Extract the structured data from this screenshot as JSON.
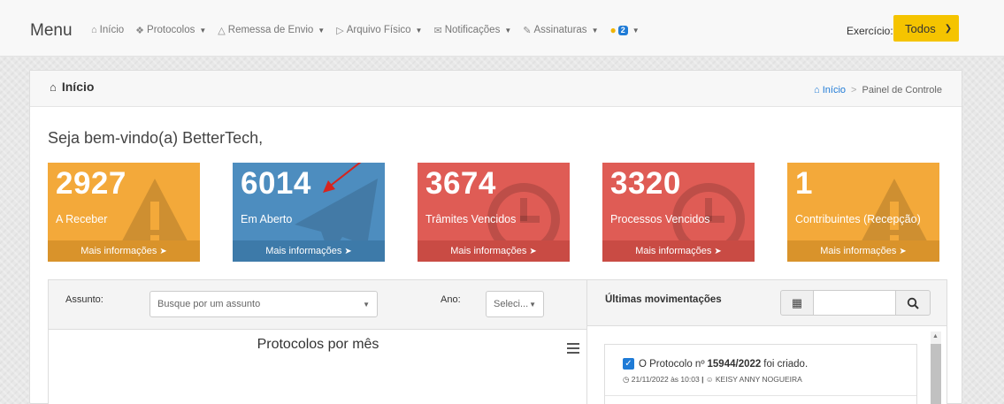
{
  "navbar": {
    "brand": "Menu",
    "items": [
      {
        "label": "Início",
        "icon": "home-icon"
      },
      {
        "label": "Protocolos",
        "icon": "protocol-icon"
      },
      {
        "label": "Remessa de Envio",
        "icon": "send-icon"
      },
      {
        "label": "Arquivo Físico",
        "icon": "folder-icon"
      },
      {
        "label": "Notificações",
        "icon": "envelope-icon"
      },
      {
        "label": "Assinaturas",
        "icon": "edit-icon"
      }
    ],
    "notifications_count": "2",
    "exercicio_label": "Exercício:",
    "exercicio_value": "Todos"
  },
  "panel": {
    "title": "Início",
    "breadcrumb_home": "Início",
    "breadcrumb_current": "Painel de Controle"
  },
  "welcome": "Seja bem-vindo(a) BetterTech,",
  "boxes": [
    {
      "number": "2927",
      "label": "A Receber",
      "footer": "Mais informações",
      "color": "#f3a93a",
      "icon": "warning-icon"
    },
    {
      "number": "6014",
      "label": "Em Aberto",
      "footer": "Mais informações",
      "color": "#4d8dbf",
      "icon": "paper-plane-icon"
    },
    {
      "number": "3674",
      "label": "Trâmites Vencidos",
      "footer": "Mais informações",
      "color": "#df5c55",
      "icon": "clock-icon"
    },
    {
      "number": "3320",
      "label": "Processos Vencidos",
      "footer": "Mais informações",
      "color": "#df5c55",
      "icon": "clock-icon"
    },
    {
      "number": "1",
      "label": "Contribuintes (Recepção)",
      "footer": "Mais informações",
      "color": "#f3a93a",
      "icon": "warning-icon"
    }
  ],
  "filters": {
    "subject_label": "Assunto:",
    "subject_placeholder": "Busque por um assunto",
    "year_label": "Ano:",
    "year_value": "Seleci..."
  },
  "chart": {
    "title": "Protocolos por mês"
  },
  "movements": {
    "title": "Últimas movimentações",
    "item": {
      "prefix": "O Protocolo nº",
      "number": "15944/2022",
      "suffix": "foi criado.",
      "timestamp": "21/11/2022 às 10:03",
      "user": "KEISY ANNY NOGUEIRA"
    }
  }
}
